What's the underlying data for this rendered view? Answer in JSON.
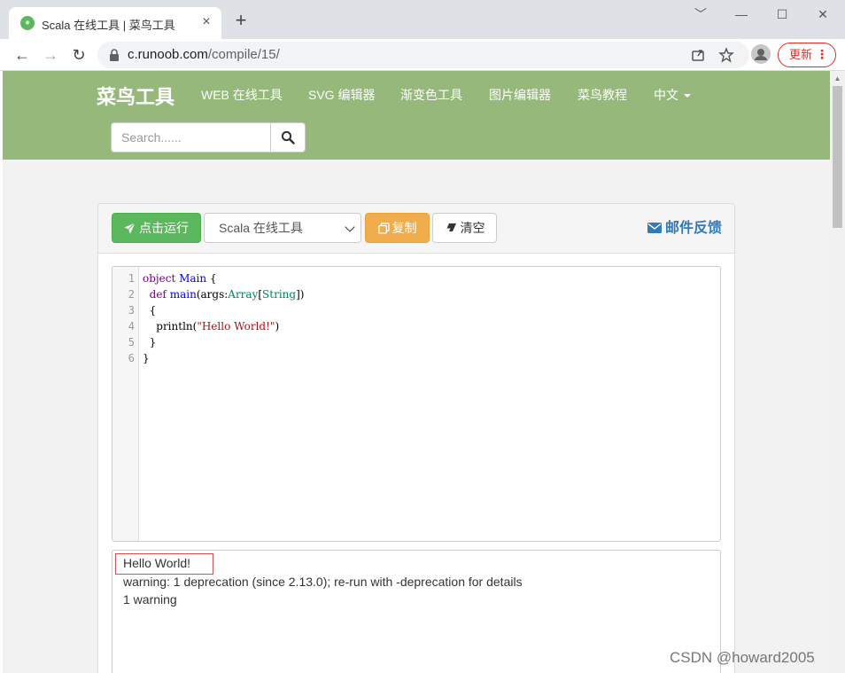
{
  "browser": {
    "tab": {
      "title": "Scala 在线工具 | 菜鸟工具",
      "favicon": "runoob-favicon"
    },
    "new_tab_symbol": "+",
    "window_controls": {
      "dropdown": "﹀",
      "minimize": "—",
      "maximize": "☐",
      "close": "✕"
    },
    "address": {
      "host": "c.runoob.com",
      "path": "/compile/15/"
    },
    "update_label": "更新",
    "update_dots": "⋮"
  },
  "site": {
    "brand": "菜鸟工具",
    "nav": [
      "WEB 在线工具",
      "SVG 编辑器",
      "渐变色工具",
      "图片编辑器",
      "菜鸟教程",
      "中文"
    ],
    "search": {
      "placeholder": "Search......"
    }
  },
  "toolbar": {
    "run_label": "点击运行",
    "language_selected": "Scala 在线工具",
    "copy_label": "复制",
    "clear_label": "清空",
    "feedback_label": "邮件反馈"
  },
  "editor": {
    "line_numbers": [
      "1",
      "2",
      "3",
      "4",
      "5",
      "6"
    ],
    "code": {
      "l1_kw": "object",
      "l1_name": "Main",
      "l1_rest": " {",
      "l2_indent": "  ",
      "l2_kw": "def",
      "l2_name": "main",
      "l2_args": "(args:",
      "l2_type1": "Array",
      "l2_br1": "[",
      "l2_type2": "String",
      "l2_br2": "])",
      "l3": "  {",
      "l4_call": "    println(",
      "l4_str": "\"Hello World!\"",
      "l4_end": ")",
      "l5": "  }",
      "l6": "}"
    }
  },
  "output": {
    "lines": [
      "Hello World!",
      "warning: 1 deprecation (since 2.13.0); re-run with -deprecation for details",
      "1 warning"
    ]
  },
  "watermark": "CSDN @howard2005",
  "colors": {
    "header_bg": "#96b97b",
    "run_button": "#5cb85c",
    "copy_button": "#f0ad4e",
    "feedback_link": "#337ab7",
    "highlight_box": "#d9534f"
  }
}
